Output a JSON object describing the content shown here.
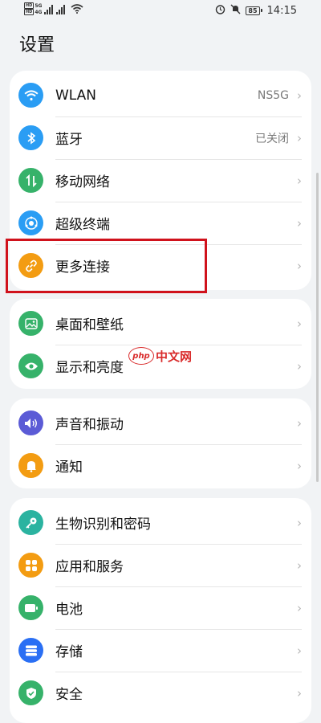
{
  "status_bar": {
    "left_tags": [
      "HD",
      "HD"
    ],
    "network_labels": [
      "5G",
      "4G"
    ],
    "battery": "85",
    "time": "14:15",
    "icons": [
      "alarm-icon",
      "mute-icon",
      "wifi-icon",
      "signal-icon"
    ]
  },
  "page": {
    "title": "设置"
  },
  "groups": [
    {
      "items": [
        {
          "label": "WLAN",
          "value": "NS5G",
          "icon": "wifi-icon",
          "color": "#2a9df4"
        },
        {
          "label": "蓝牙",
          "value": "已关闭",
          "icon": "bluetooth-icon",
          "color": "#2a9df4"
        },
        {
          "label": "移动网络",
          "icon": "mobile-data-icon",
          "color": "#36b26a"
        },
        {
          "label": "超级终端",
          "icon": "super-device-icon",
          "color": "#2a9df4"
        },
        {
          "label": "更多连接",
          "icon": "link-icon",
          "color": "#f39c12"
        }
      ]
    },
    {
      "items": [
        {
          "label": "桌面和壁纸",
          "icon": "wallpaper-icon",
          "color": "#36b26a"
        },
        {
          "label": "显示和亮度",
          "icon": "eye-icon",
          "color": "#36b26a"
        }
      ]
    },
    {
      "items": [
        {
          "label": "声音和振动",
          "icon": "speaker-icon",
          "color": "#5b5bd6"
        },
        {
          "label": "通知",
          "icon": "bell-icon",
          "color": "#f39c12"
        }
      ]
    },
    {
      "items": [
        {
          "label": "生物识别和密码",
          "icon": "key-icon",
          "color": "#2bb3a0"
        },
        {
          "label": "应用和服务",
          "icon": "apps-icon",
          "color": "#f39c12"
        },
        {
          "label": "电池",
          "icon": "battery-icon",
          "color": "#36b26a"
        },
        {
          "label": "存储",
          "icon": "storage-icon",
          "color": "#2a6ff4"
        },
        {
          "label": "安全",
          "icon": "shield-icon",
          "color": "#36b26a"
        }
      ]
    }
  ],
  "watermark": {
    "logo": "php",
    "text": "中文网"
  },
  "chevron": "›"
}
